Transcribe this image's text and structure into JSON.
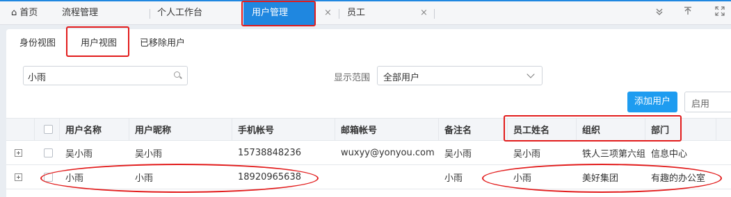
{
  "top_tabs": {
    "home": "首页",
    "items": [
      {
        "label": "流程管理"
      },
      {
        "label": "个人工作台"
      },
      {
        "label": "用户管理",
        "close": "×"
      },
      {
        "label": "员工",
        "close": "×"
      }
    ]
  },
  "colors": {
    "accent": "#1f87e0",
    "highlight": "#e21b1b",
    "add_button": "#1e9cf0"
  },
  "icons": [
    "home-icon",
    "chevron-double-down-icon",
    "upload-icon",
    "expand-icon"
  ],
  "sub_tabs": [
    "身份视图",
    "用户视图",
    "已移除用户"
  ],
  "search": {
    "value": "小雨"
  },
  "filter": {
    "label": "显示范围",
    "value": "全部用户"
  },
  "toolbar": {
    "add_user": "添加用户",
    "status": "启用"
  },
  "table": {
    "columns": [
      "用户名称",
      "用户昵称",
      "手机帐号",
      "邮箱帐号",
      "备注名",
      "员工姓名",
      "组织",
      "部门"
    ],
    "rows": [
      [
        "吴小雨",
        "吴小雨",
        "15738848236",
        "wuxyy@yonyou.com",
        "吴小雨",
        "吴小雨",
        "铁人三项第六组",
        "信息中心"
      ],
      [
        "小雨",
        "小雨",
        "18920965638",
        "",
        "小雨",
        "小雨",
        "美好集团",
        "有趣的办公室"
      ]
    ]
  }
}
